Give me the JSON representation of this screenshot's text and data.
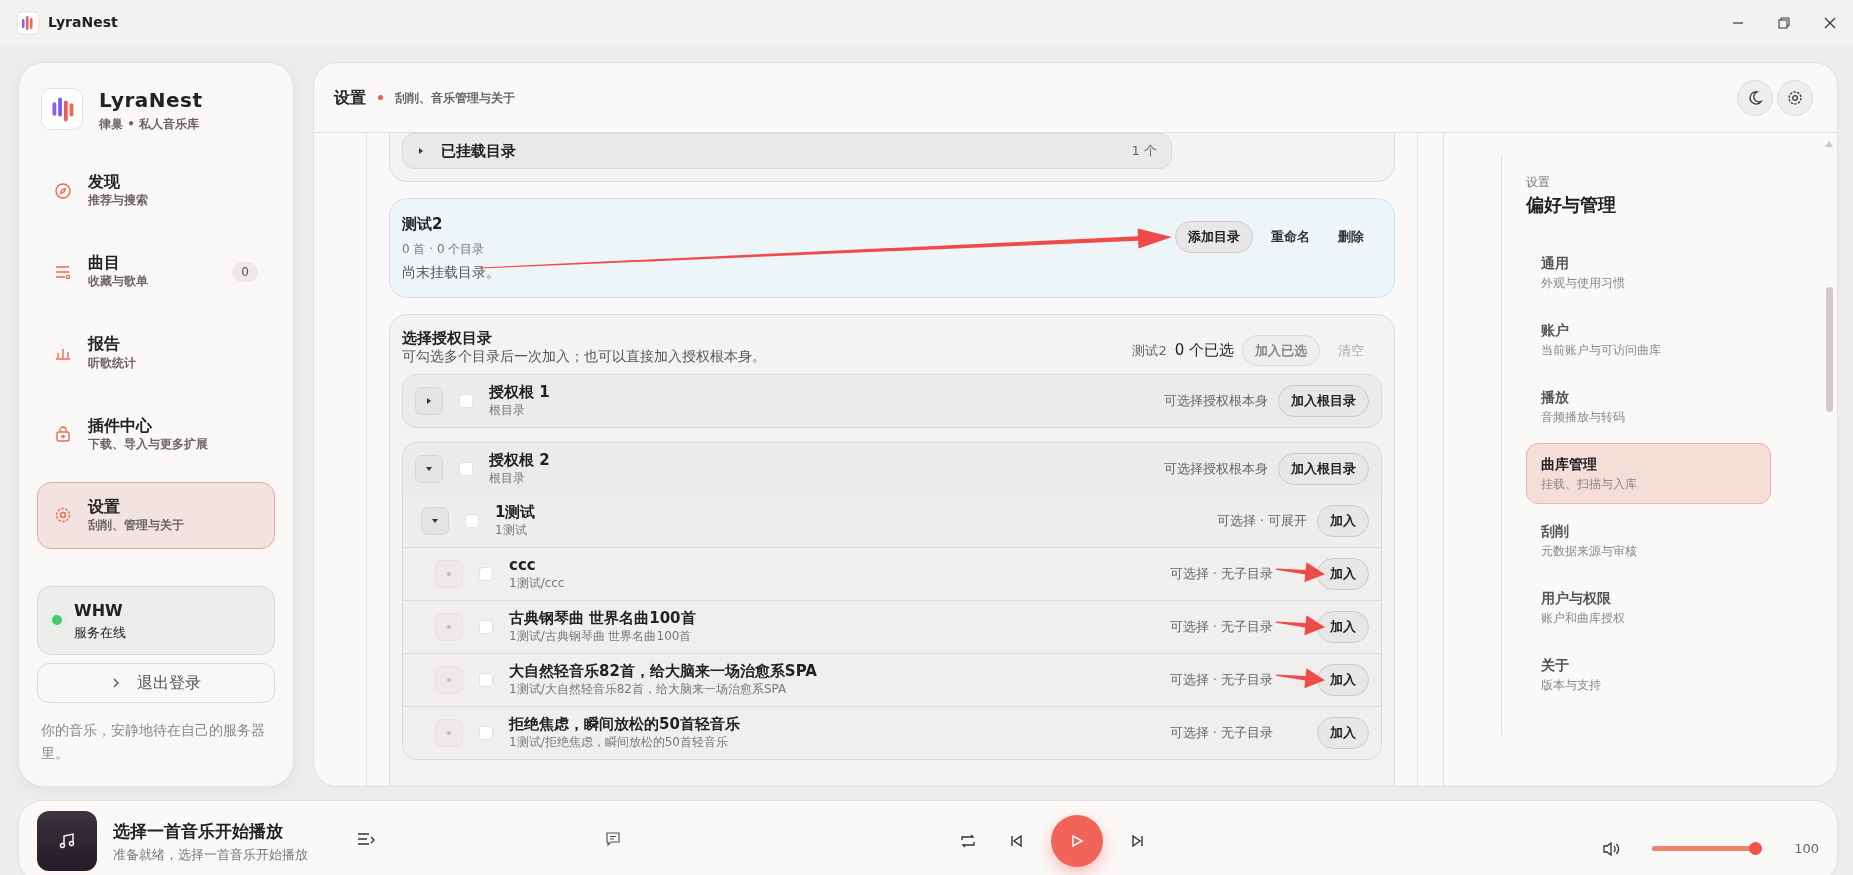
{
  "window": {
    "title": "LyraNest"
  },
  "sidebar": {
    "brand": "LyraNest",
    "tagline": "律巢 • 私人音乐库",
    "items": [
      {
        "label": "发现",
        "sub": "推荐与搜索",
        "selected": false
      },
      {
        "label": "曲目",
        "sub": "收藏与歌单",
        "badge": "0",
        "selected": false
      },
      {
        "label": "报告",
        "sub": "听歌统计",
        "selected": false
      },
      {
        "label": "插件中心",
        "sub": "下载、导入与更多扩展",
        "selected": false
      },
      {
        "label": "设置",
        "sub": "刮削、管理与关于",
        "selected": true
      }
    ],
    "server": {
      "name": "WHW",
      "status": "服务在线",
      "online": true
    },
    "logout": "退出登录",
    "footer": "你的音乐，安静地待在自己的服务器里。"
  },
  "header": {
    "title": "设置",
    "subtitle": "刮削、音乐管理与关于"
  },
  "mounted": {
    "label": "已挂载目录",
    "count": "1 个",
    "expanded": false
  },
  "library": {
    "name": "测试2",
    "meta": "0 首 · 0 个目录",
    "empty": "尚末挂载目录。",
    "selected": true,
    "buttons": [
      "添加目录",
      "重命名",
      "删除"
    ]
  },
  "picker": {
    "title": "选择授权目录",
    "hint": "可勾选多个目录后一次加入；也可以直接加入授权根本身。",
    "target": "测试2",
    "selected_count": "0 个已选",
    "add_selected": {
      "label": "加入已选",
      "disabled": true
    },
    "clear": {
      "label": "清空",
      "disabled": true
    },
    "roots": [
      {
        "name": "授权根 1",
        "sub": "根目录",
        "note": "可选择授权根本身",
        "button": "加入根目录",
        "kind": "folder",
        "expanded": false,
        "checked": false
      },
      {
        "name": "授权根 2",
        "sub": "根目录",
        "note": "可选择授权根本身",
        "button": "加入根目录",
        "kind": "folder",
        "expanded": true,
        "checked": false,
        "children": [
          {
            "name": "1测试",
            "sub": "1测试",
            "note": "可选择 · 可展开",
            "button": "加入",
            "kind": "folder",
            "expanded": true,
            "checked": false,
            "children": [
              {
                "name": "ccc",
                "sub": "1测试/ccc",
                "note": "可选择 · 无子目录",
                "button": "加入",
                "kind": "leaf",
                "checked": false,
                "arrow": true
              },
              {
                "name": "古典钢琴曲 世界名曲100首",
                "sub": "1测试/古典钢琴曲 世界名曲100首",
                "note": "可选择 · 无子目录",
                "button": "加入",
                "kind": "leaf",
                "checked": false,
                "arrow": true
              },
              {
                "name": "大自然轻音乐82首，给大脑来一场治愈系SPA",
                "sub": "1测试/大自然轻音乐82首，给大脑来一场治愈系SPA",
                "note": "可选择 · 无子目录",
                "button": "加入",
                "kind": "leaf",
                "checked": false,
                "arrow": true
              },
              {
                "name": "拒绝焦虑，瞬间放松的50首轻音乐",
                "sub": "1测试/拒绝焦虑，瞬间放松的50首轻音乐",
                "note": "可选择 · 无子目录",
                "button": "加入",
                "kind": "leaf",
                "checked": false,
                "arrow": false
              }
            ]
          }
        ]
      }
    ]
  },
  "settings_nav": {
    "eyebrow": "设置",
    "title": "偏好与管理",
    "items": [
      {
        "label": "通用",
        "sub": "外观与使用习惯",
        "selected": false
      },
      {
        "label": "账户",
        "sub": "当前账户与可访问曲库",
        "selected": false
      },
      {
        "label": "播放",
        "sub": "音频播放与转码",
        "selected": false
      },
      {
        "label": "曲库管理",
        "sub": "挂载、扫描与入库",
        "selected": true
      },
      {
        "label": "刮削",
        "sub": "元数据来源与审核",
        "selected": false
      },
      {
        "label": "用户与权限",
        "sub": "账户和曲库授权",
        "selected": false
      },
      {
        "label": "关于",
        "sub": "版本与支持",
        "selected": false
      }
    ]
  },
  "player": {
    "title": "选择一首音乐开始播放",
    "status": "准备就绪，选择一首音乐开始播放",
    "volume": {
      "level": 1.0,
      "reading": "100"
    }
  }
}
